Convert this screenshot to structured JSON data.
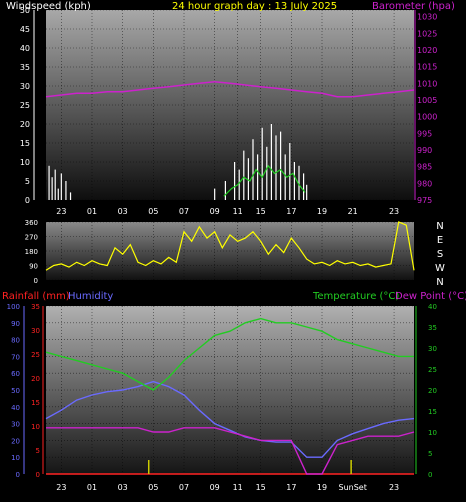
{
  "colors": {
    "background": "#000000",
    "windspeed": "#ffffff",
    "wind_gust": "#c8c8c8",
    "wind_avg": "#22cc22",
    "barometer": "#cc22cc",
    "direction": "#ffff00",
    "rainfall": "#ff2222",
    "humidity": "#6a6aff",
    "temperature": "#22cc22",
    "dewpoint": "#cc22cc",
    "title": "#ffff00",
    "axis_white": "#ffffff"
  },
  "chart_data": [
    {
      "id": "wind-baro",
      "type": "line",
      "title": "24 hour graph day : 13 July 2025",
      "left_label": "Windspeed (kph)",
      "right_label": "Barometer (hpa)",
      "x_ticks": [
        "23",
        "01",
        "03",
        "05",
        "07",
        "09",
        "11",
        "15",
        "17",
        "19",
        "21",
        "23"
      ],
      "y_left_ticks": [
        "0",
        "5",
        "10",
        "15",
        "20",
        "25",
        "30",
        "35",
        "40",
        "45",
        "50"
      ],
      "y_right_ticks": [
        "975",
        "980",
        "985",
        "990",
        "995",
        "1000",
        "1005",
        "1010",
        "1015",
        "1020",
        "1025",
        "1030"
      ],
      "ylim_left": [
        0,
        50
      ],
      "ylim_right": [
        975,
        1032
      ],
      "grid": true,
      "barometer": {
        "name": "Barometer",
        "x": [
          0,
          1,
          2,
          3,
          4,
          5,
          6,
          7,
          8,
          9,
          10,
          11,
          12,
          13,
          14,
          15,
          16,
          17,
          18,
          19,
          20,
          21,
          22,
          23,
          24
        ],
        "values": [
          1006,
          1006.5,
          1007,
          1007,
          1007.5,
          1007.5,
          1008,
          1008.5,
          1009,
          1009.5,
          1010,
          1010.5,
          1010,
          1009.5,
          1009,
          1008.5,
          1008,
          1007.5,
          1007,
          1006,
          1006,
          1006.5,
          1007,
          1007.5,
          1008
        ]
      },
      "wind_bursts": [
        {
          "name": "gust",
          "x": [
            0.2,
            0.4,
            0.6,
            0.8,
            1.0,
            1.3,
            1.6,
            11.0,
            11.7,
            12.3,
            12.6,
            12.9,
            13.2,
            13.5,
            13.8,
            14.1,
            14.4,
            14.7,
            15.0,
            15.3,
            15.6,
            15.9,
            16.2,
            16.5,
            16.8,
            17.0
          ],
          "values": [
            9,
            6,
            8,
            3,
            7,
            5,
            2,
            3,
            5,
            10,
            8,
            13,
            11,
            16,
            12,
            19,
            14,
            20,
            17,
            18,
            12,
            15,
            10,
            9,
            7,
            4
          ]
        },
        {
          "name": "average",
          "x": [
            11.6,
            12.1,
            12.5,
            12.9,
            13.3,
            13.7,
            14.1,
            14.5,
            14.9,
            15.3,
            15.7,
            16.1,
            16.5,
            16.9
          ],
          "values": [
            1,
            3,
            4,
            6,
            5,
            8,
            6,
            9,
            7,
            8,
            6,
            7,
            4,
            2
          ]
        }
      ]
    },
    {
      "id": "wind-direction",
      "type": "line",
      "x_ticks_shared": true,
      "y_left_ticks": [
        "0",
        "90",
        "180",
        "270",
        "360"
      ],
      "y_right_ticks": [
        "N",
        "E",
        "S",
        "W",
        "N"
      ],
      "ylim": [
        0,
        360
      ],
      "grid": true,
      "x": [
        0,
        0.5,
        1,
        1.5,
        2,
        2.5,
        3,
        3.5,
        4,
        4.5,
        5,
        5.5,
        6,
        6.5,
        7,
        7.5,
        8,
        8.5,
        9,
        9.5,
        10,
        10.5,
        11,
        11.5,
        12,
        12.5,
        13,
        13.5,
        14,
        14.5,
        15,
        15.5,
        16,
        16.5,
        17,
        17.5,
        18,
        18.5,
        19,
        19.5,
        20,
        20.5,
        21,
        21.5,
        22,
        22.5,
        23,
        23.5,
        24
      ],
      "values": [
        60,
        90,
        100,
        80,
        110,
        90,
        120,
        100,
        90,
        200,
        160,
        220,
        110,
        90,
        120,
        100,
        140,
        110,
        300,
        240,
        330,
        260,
        300,
        200,
        280,
        240,
        260,
        300,
        240,
        160,
        220,
        170,
        260,
        200,
        130,
        100,
        110,
        90,
        120,
        100,
        110,
        90,
        100,
        80,
        90,
        100,
        360,
        340,
        60
      ]
    },
    {
      "id": "temp-hum-rain",
      "type": "line",
      "left_label": "Rainfall (mm)",
      "left2_label": "Humidity",
      "right_label_temp": "Temperature (°C)",
      "right_label_dew": "Dew Point (°C)",
      "x_ticks": [
        "23",
        "01",
        "03",
        "05",
        "07",
        "09",
        "11",
        "15",
        "17",
        "19",
        "SunSet",
        "23"
      ],
      "y_humidity_ticks": [
        "0",
        "10",
        "20",
        "30",
        "40",
        "50",
        "60",
        "70",
        "80",
        "90",
        "100"
      ],
      "y_rain_ticks": [
        "0",
        "5",
        "10",
        "15",
        "20",
        "25",
        "30",
        "35"
      ],
      "y_temp_ticks": [
        "0",
        "5",
        "10",
        "15",
        "20",
        "25",
        "30",
        "35",
        "40"
      ],
      "ylim_humidity": [
        0,
        100
      ],
      "ylim_rain": [
        0,
        35
      ],
      "ylim_temp": [
        0,
        40
      ],
      "grid": true,
      "temperature": {
        "name": "Temperature",
        "x": [
          0,
          1,
          2,
          3,
          4,
          5,
          6,
          7,
          8,
          9,
          10,
          11,
          12,
          13,
          14,
          15,
          16,
          17,
          18,
          19,
          20,
          21,
          22,
          23,
          24
        ],
        "values": [
          29,
          28,
          27,
          26,
          25,
          24,
          22,
          20,
          23,
          27,
          30,
          33,
          34,
          36,
          37,
          36,
          36,
          35,
          34,
          32,
          31,
          30,
          29,
          28,
          28
        ]
      },
      "dewpoint": {
        "name": "Dew Point",
        "x": [
          0,
          1,
          2,
          3,
          4,
          5,
          6,
          7,
          8,
          9,
          10,
          11,
          12,
          13,
          14,
          15,
          16,
          17,
          18,
          19,
          20,
          21,
          22,
          23,
          24
        ],
        "values": [
          11,
          11,
          11,
          11,
          11,
          11,
          11,
          10,
          10,
          11,
          11,
          11,
          10,
          9,
          8,
          8,
          8,
          0,
          0,
          7,
          8,
          9,
          9,
          9,
          10
        ]
      },
      "humidity": {
        "name": "Humidity",
        "x": [
          0,
          1,
          2,
          3,
          4,
          5,
          6,
          7,
          8,
          9,
          10,
          11,
          12,
          13,
          14,
          15,
          16,
          17,
          18,
          19,
          20,
          21,
          22,
          23,
          24
        ],
        "values": [
          33,
          38,
          44,
          47,
          49,
          50,
          52,
          55,
          52,
          47,
          38,
          30,
          26,
          22,
          20,
          19,
          19,
          10,
          10,
          20,
          24,
          27,
          30,
          32,
          33
        ]
      },
      "rainfall": {
        "name": "Rainfall",
        "x": [
          0,
          24
        ],
        "values": [
          0,
          0
        ]
      },
      "markers": [
        {
          "label": "sunrise",
          "x": 6.7
        },
        {
          "label": "sunset",
          "x": 19.9
        }
      ]
    }
  ]
}
